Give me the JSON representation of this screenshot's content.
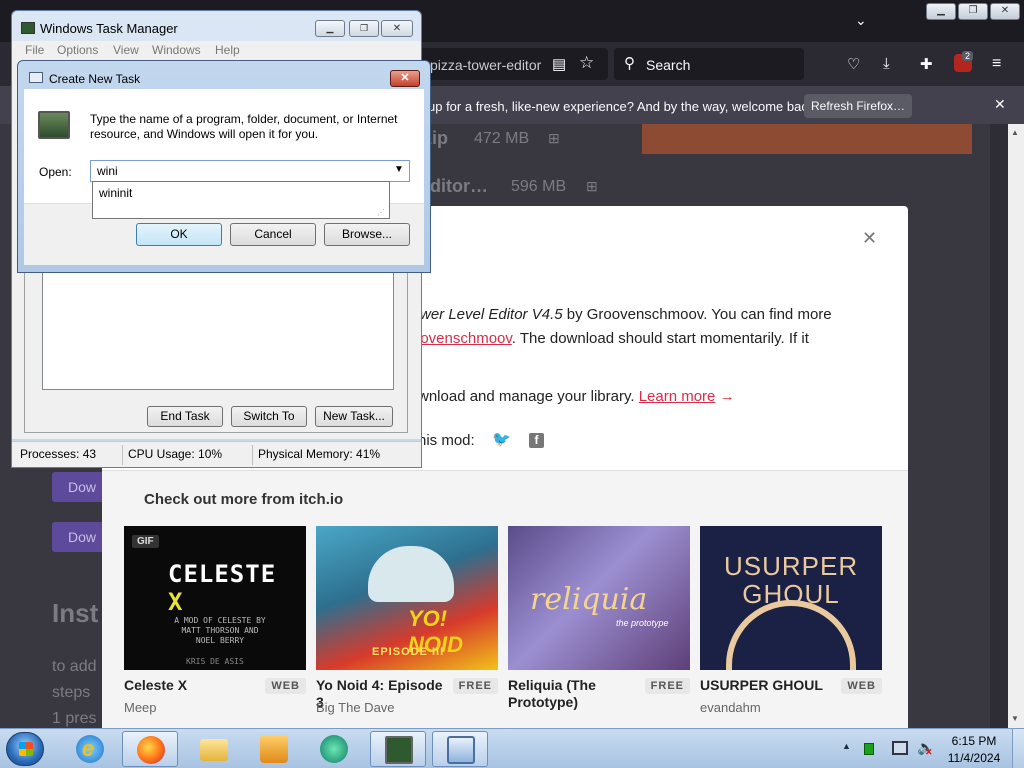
{
  "firefox": {
    "url": "pizza-tower-editor",
    "search_placeholder": "Search",
    "ublock_count": "2",
    "notification_text": "up for a fresh, like-new experience? And by the way, welcome back!",
    "refresh_button": "Refresh Firefox…"
  },
  "page": {
    "file1_name": ".zip",
    "file1_size": "472 MB",
    "file2_name": "Editor…",
    "file2_size": "596 MB",
    "download_label": "Dow",
    "install_heading": "Inst",
    "install_line1": "to add",
    "install_line2": "steps",
    "install_line3": "1 pres"
  },
  "modal": {
    "close": "✕",
    "p1_prefix_italic": "wer Level Editor V4.5",
    "p1_suffix": " by Groovenschmoov. You can find more",
    "p1b_link": "oovenschmoov",
    "p1b_suffix": ". The download should start momentarily. If it",
    "p2_prefix": "wnload and manage your library. ",
    "learn_more": "Learn more",
    "learn_arrow": " →",
    "share_label": "his mod:",
    "more_title": "Check out more from itch.io",
    "games": [
      {
        "title": "Celeste X",
        "badge": "WEB",
        "author": "Meep"
      },
      {
        "title": "Yo Noid 4: Episode 3",
        "badge": "FREE",
        "author": "Big The Dave"
      },
      {
        "title": "Reliquia (The Prototype)",
        "badge": "FREE",
        "author": ""
      },
      {
        "title": "USURPER GHOUL",
        "badge": "WEB",
        "author": "evandahm"
      }
    ],
    "thumb_texts": {
      "gif": "GIF",
      "celeste_main": "CELESTE",
      "celeste_x": "X",
      "celeste_credit": "A MOD OF CELESTE BY MATT THORSON AND NOEL BERRY",
      "celeste_foot": "KRIS DE ASIS",
      "yonoid": "YO! NOID",
      "yonoid_ep": "EPISODE III",
      "reliquia": "reliquia",
      "reliquia_sub": "the prototype",
      "usurper": "USURPER GHOUL"
    }
  },
  "taskmanager": {
    "title": "Windows Task Manager",
    "menu": [
      "File",
      "Options",
      "View",
      "Windows",
      "Help"
    ],
    "buttons": {
      "end_task": "End Task",
      "switch_to": "Switch To",
      "new_task": "New Task..."
    },
    "status": {
      "processes": "Processes: 43",
      "cpu": "CPU Usage: 10%",
      "memory": "Physical Memory: 41%"
    }
  },
  "create_new_task": {
    "title": "Create New Task",
    "description": "Type the name of a program, folder, document, or Internet resource, and Windows will open it for you.",
    "open_label": "Open:",
    "open_value": "wini",
    "suggestion": "wininit",
    "ok": "OK",
    "cancel": "Cancel",
    "browse": "Browse..."
  },
  "taskbar": {
    "time": "6:15 PM",
    "date": "11/4/2024"
  },
  "colors": {
    "firefox_dark": "#1c1b22",
    "link_red": "#da2c49",
    "win7_glass": "#c7d8ee",
    "purple_button": "#5e4a9a"
  }
}
